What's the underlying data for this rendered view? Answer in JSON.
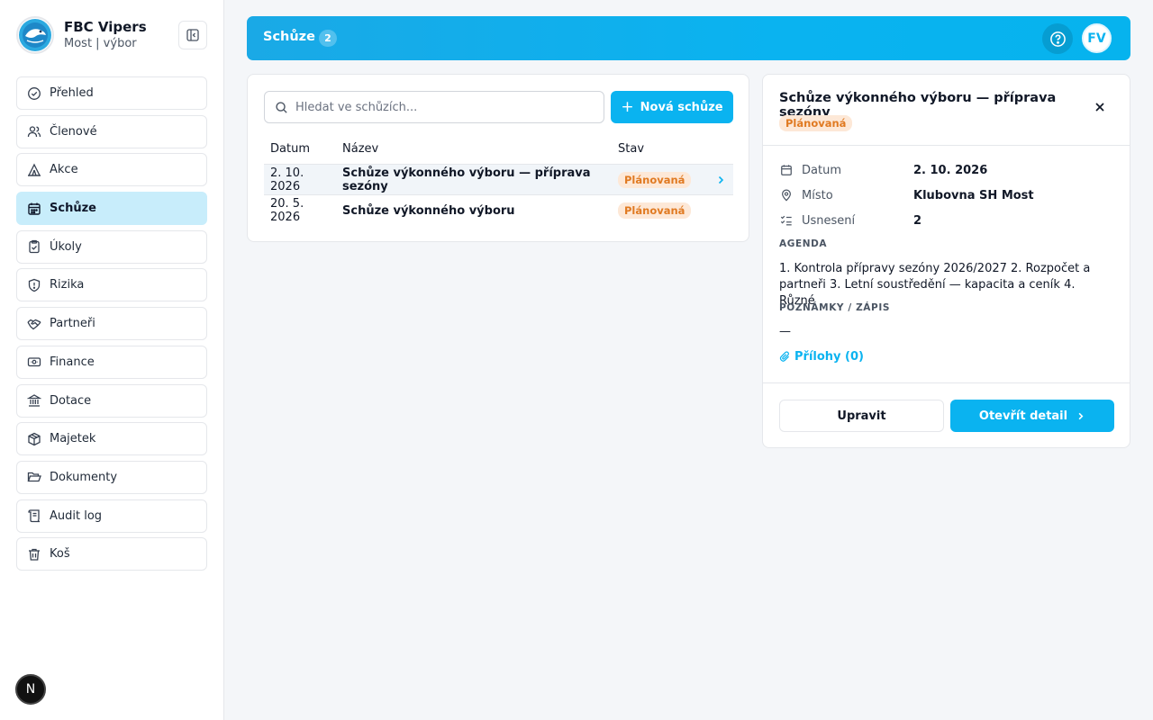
{
  "brand": {
    "name": "FBC Vipers",
    "subtitle": "Most | výbor"
  },
  "sidebar": {
    "items": [
      {
        "label": "Přehled",
        "icon": "check-circle-icon"
      },
      {
        "label": "Členové",
        "icon": "users-icon"
      },
      {
        "label": "Akce",
        "icon": "tent-icon"
      },
      {
        "label": "Schůze",
        "icon": "calendar-icon",
        "active": true
      },
      {
        "label": "Úkoly",
        "icon": "clipboard-check-icon"
      },
      {
        "label": "Rizika",
        "icon": "shield-icon"
      },
      {
        "label": "Partneři",
        "icon": "handshake-icon"
      },
      {
        "label": "Finance",
        "icon": "banknote-icon"
      },
      {
        "label": "Dotace",
        "icon": "landmark-icon"
      },
      {
        "label": "Majetek",
        "icon": "package-icon"
      },
      {
        "label": "Dokumenty",
        "icon": "folder-open-icon"
      },
      {
        "label": "Audit log",
        "icon": "scroll-icon"
      },
      {
        "label": "Koš",
        "icon": "trash-icon"
      }
    ],
    "bottom_badge": "N"
  },
  "header": {
    "title": "Schůze",
    "count": "2",
    "avatar_initials": "FV"
  },
  "list": {
    "search_placeholder": "Hledat ve schůzích...",
    "new_button": "Nová schůze",
    "columns": {
      "date": "Datum",
      "name": "Název",
      "status": "Stav"
    },
    "rows": [
      {
        "date": "2. 10. 2026",
        "name": "Schůze výkonného výboru — příprava sezóny",
        "status": "Plánovaná",
        "selected": true
      },
      {
        "date": "20. 5. 2026",
        "name": "Schůze výkonného výboru",
        "status": "Plánovaná",
        "selected": false
      }
    ]
  },
  "detail": {
    "title": "Schůze výkonného výboru — příprava sezóny",
    "status": "Plánovaná",
    "meta": {
      "date_label": "Datum",
      "date_value": "2. 10. 2026",
      "place_label": "Místo",
      "place_value": "Klubovna SH Most",
      "resolutions_label": "Usnesení",
      "resolutions_value": "2"
    },
    "agenda_label": "AGENDA",
    "agenda_text": "1. Kontrola přípravy sezóny 2026/2027 2. Rozpočet a partneři 3. Letní soustředění — kapacita a ceník 4. Různé",
    "notes_label": "POZNÁMKY / ZÁPIS",
    "notes_text": "—",
    "attachments_label": "Přílohy (0)",
    "edit_button": "Upravit",
    "open_button": "Otevřít detail"
  },
  "colors": {
    "accent": "#0ab3f0",
    "active_nav": "#c8edfb",
    "status_pill_bg": "#fde8d7",
    "status_pill_text": "#e07a22"
  }
}
